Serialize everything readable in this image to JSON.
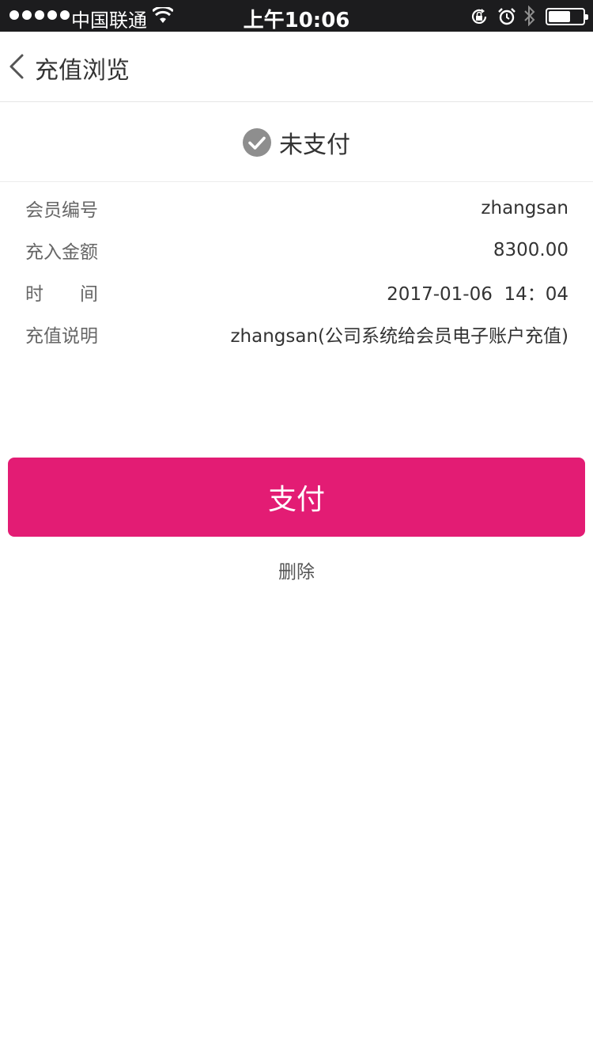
{
  "status_bar": {
    "carrier": "中国联通",
    "time": "上午10:06",
    "battery_level": 0.65
  },
  "nav": {
    "title": "充值浏览",
    "back_icon": "chevron-left-icon"
  },
  "payment_status": {
    "icon": "check-circle-icon",
    "text": "未支付",
    "icon_color": "#8e8e8e"
  },
  "details": [
    {
      "label": "会员编号",
      "value": "zhangsan"
    },
    {
      "label": "充入金额",
      "value": "8300.00"
    },
    {
      "label": "时间",
      "value": "2017-01-06  14：04"
    },
    {
      "label": "充值说明",
      "value": "zhangsan(公司系统给会员电子账户充值)"
    }
  ],
  "actions": {
    "pay_label": "支付",
    "delete_label": "删除"
  },
  "colors": {
    "accent": "#e31c74",
    "status_bar_bg": "#1c1c1e"
  }
}
